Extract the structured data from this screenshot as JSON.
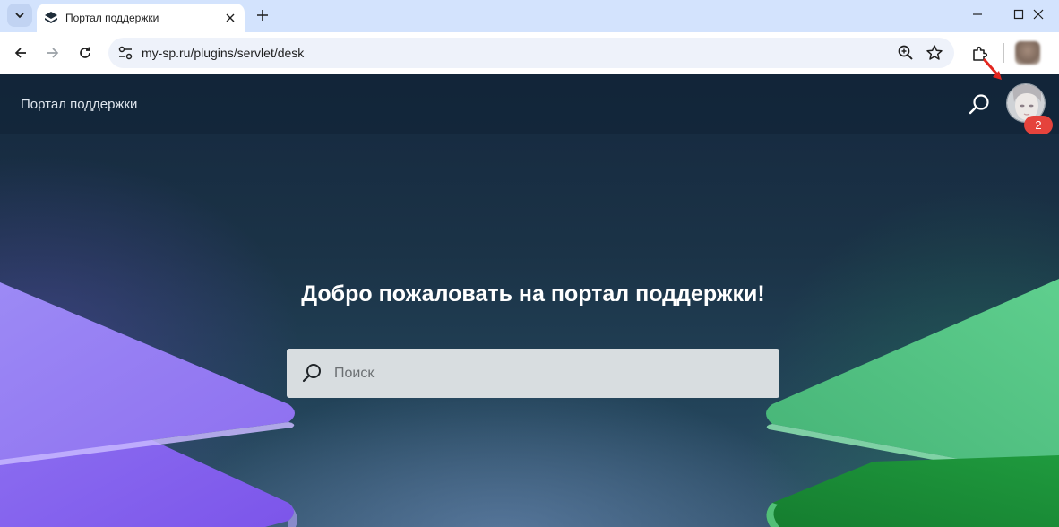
{
  "browser": {
    "tab_title": "Портал поддержки",
    "url": "my-sp.ru/plugins/servlet/desk"
  },
  "header": {
    "title": "Портал поддержки",
    "notification_count": "2"
  },
  "hero": {
    "welcome": "Добро пожаловать на портал поддержки!",
    "search_placeholder": "Поиск"
  },
  "colors": {
    "accent_purple": "#9b7ff0",
    "accent_green": "#4cbb7c",
    "badge_red": "#e5433c"
  }
}
